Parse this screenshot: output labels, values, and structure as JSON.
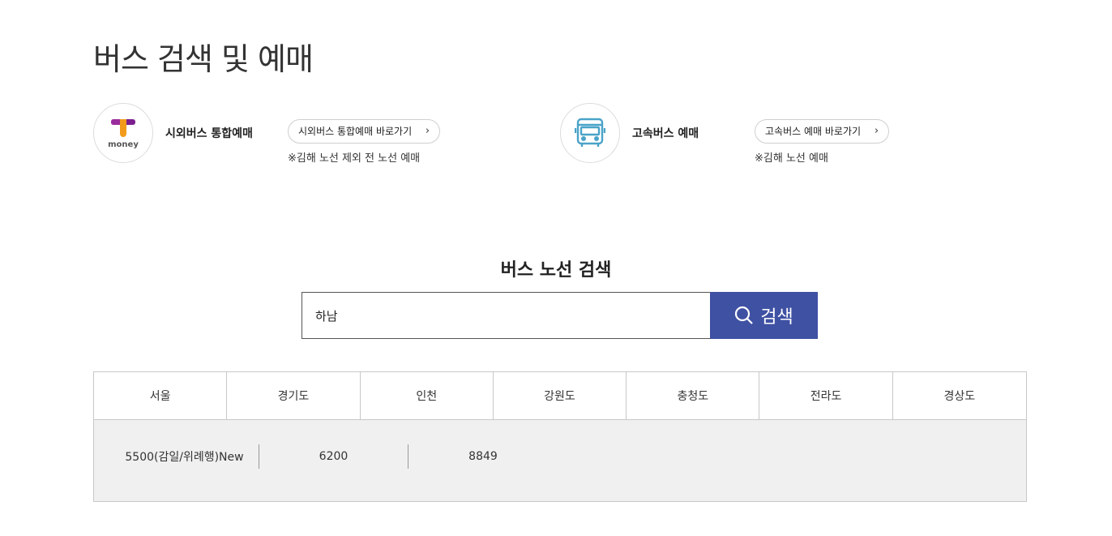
{
  "page_title": "버스 검색 및 예매",
  "services": [
    {
      "logo_text": "money",
      "name": "시외버스 통합예매",
      "button_label": "시외버스 통합예매 바로가기",
      "note": "※김해 노선 제외 전 노선 예매"
    },
    {
      "name": "고속버스 예매",
      "button_label": "고속버스 예매 바로가기",
      "note": "※김해 노선 예매"
    }
  ],
  "search": {
    "title": "버스 노선 검색",
    "value": "하남",
    "button_label": "검색"
  },
  "regions": [
    "서울",
    "경기도",
    "인천",
    "강원도",
    "충청도",
    "전라도",
    "경상도"
  ],
  "routes": [
    "5500(감일/위례행)New",
    "6200",
    "8849"
  ],
  "colors": {
    "search_button": "#3f51a3",
    "bus_icon": "#4aa3c8",
    "tmoney_purple": "#7b1f8e",
    "tmoney_orange": "#f29b1b"
  },
  "icons": {
    "chevron": "chevron-right-icon",
    "search": "search-icon",
    "bus": "bus-icon",
    "tmoney": "tmoney-logo-icon"
  }
}
